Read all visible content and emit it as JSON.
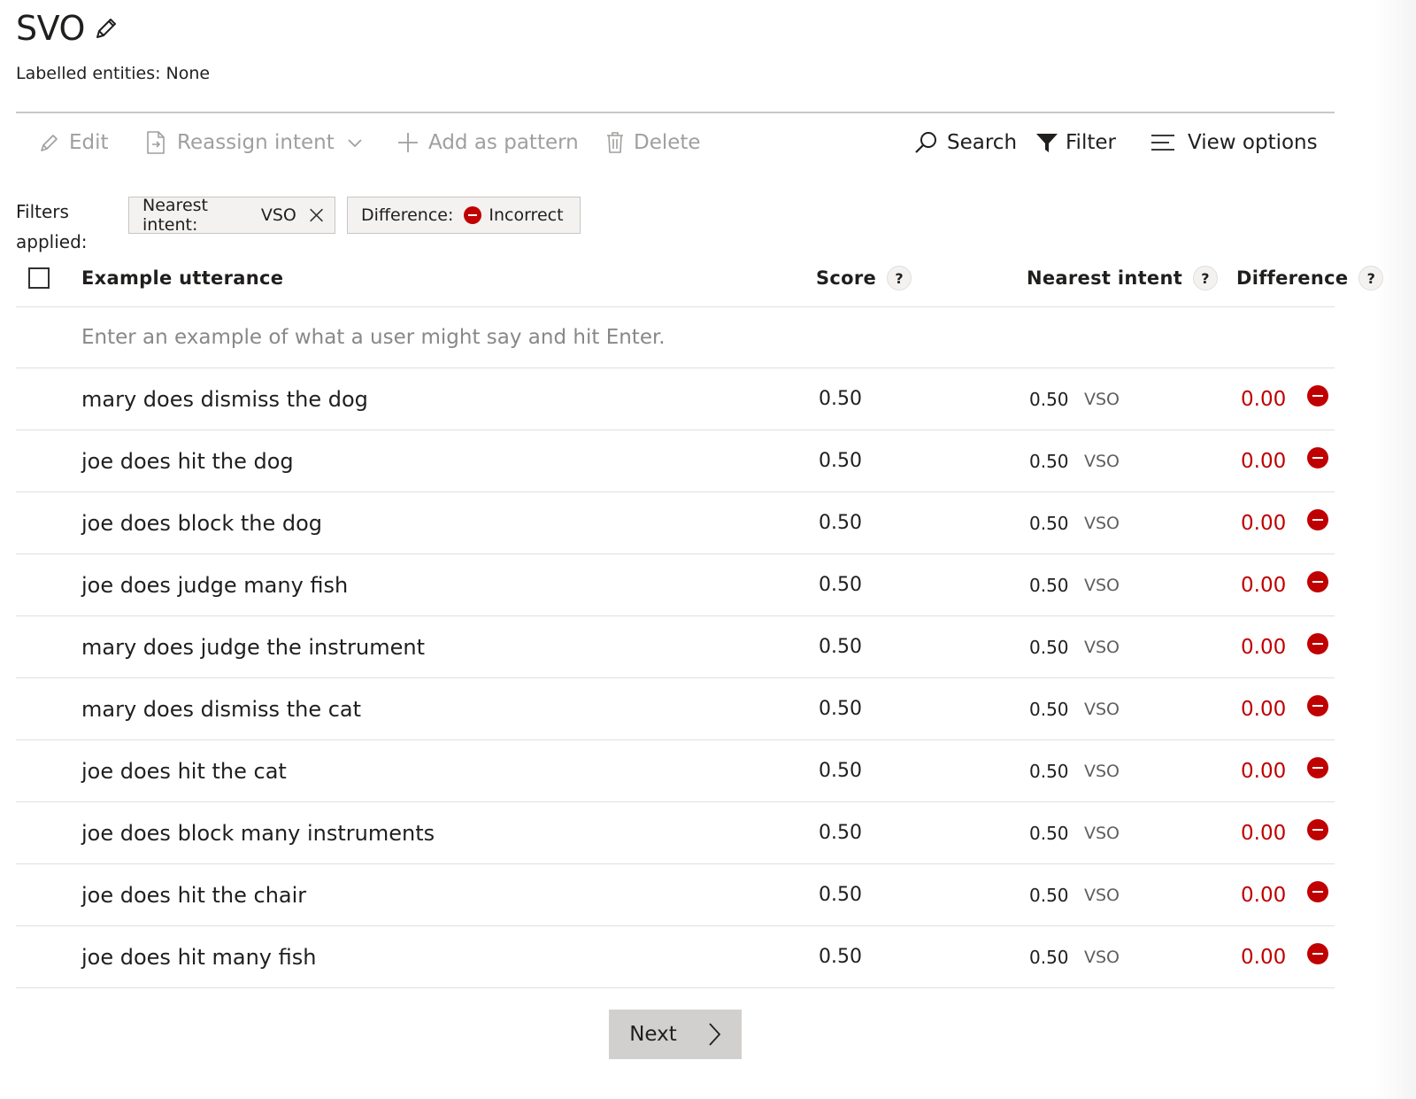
{
  "header": {
    "title": "SVO",
    "labelled_entities": "Labelled entities: None"
  },
  "toolbar": {
    "edit": "Edit",
    "reassign": "Reassign intent",
    "add_pattern": "Add as pattern",
    "delete": "Delete",
    "search": "Search",
    "filter": "Filter",
    "view_options": "View options"
  },
  "filters": {
    "label_line1": "Filters",
    "label_line2": "applied:",
    "chips": [
      {
        "key": "Nearest intent:",
        "value": "VSO"
      },
      {
        "key": "Difference:",
        "value": "Incorrect"
      }
    ]
  },
  "table": {
    "headers": {
      "utterance": "Example utterance",
      "score": "Score",
      "nearest_intent": "Nearest intent",
      "difference": "Difference",
      "help_glyph": "?"
    },
    "input_placeholder": "Enter an example of what a user might say and hit Enter.",
    "rows": [
      {
        "utterance": "mary does dismiss the dog",
        "score": "0.50",
        "nearest_score": "0.50",
        "nearest_intent": "VSO",
        "difference": "0.00"
      },
      {
        "utterance": "joe does hit the dog",
        "score": "0.50",
        "nearest_score": "0.50",
        "nearest_intent": "VSO",
        "difference": "0.00"
      },
      {
        "utterance": "joe does block the dog",
        "score": "0.50",
        "nearest_score": "0.50",
        "nearest_intent": "VSO",
        "difference": "0.00"
      },
      {
        "utterance": "joe does judge many fish",
        "score": "0.50",
        "nearest_score": "0.50",
        "nearest_intent": "VSO",
        "difference": "0.00"
      },
      {
        "utterance": "mary does judge the instrument",
        "score": "0.50",
        "nearest_score": "0.50",
        "nearest_intent": "VSO",
        "difference": "0.00"
      },
      {
        "utterance": "mary does dismiss the cat",
        "score": "0.50",
        "nearest_score": "0.50",
        "nearest_intent": "VSO",
        "difference": "0.00"
      },
      {
        "utterance": "joe does hit the cat",
        "score": "0.50",
        "nearest_score": "0.50",
        "nearest_intent": "VSO",
        "difference": "0.00"
      },
      {
        "utterance": "joe does block many instruments",
        "score": "0.50",
        "nearest_score": "0.50",
        "nearest_intent": "VSO",
        "difference": "0.00"
      },
      {
        "utterance": "joe does hit the chair",
        "score": "0.50",
        "nearest_score": "0.50",
        "nearest_intent": "VSO",
        "difference": "0.00"
      },
      {
        "utterance": "joe does hit many fish",
        "score": "0.50",
        "nearest_score": "0.50",
        "nearest_intent": "VSO",
        "difference": "0.00"
      }
    ]
  },
  "pagination": {
    "next_label": "Next"
  },
  "colors": {
    "incorrect": "#c00000",
    "disabled_text": "#a19f9d",
    "next_button_bg": "#d2d0ce"
  }
}
